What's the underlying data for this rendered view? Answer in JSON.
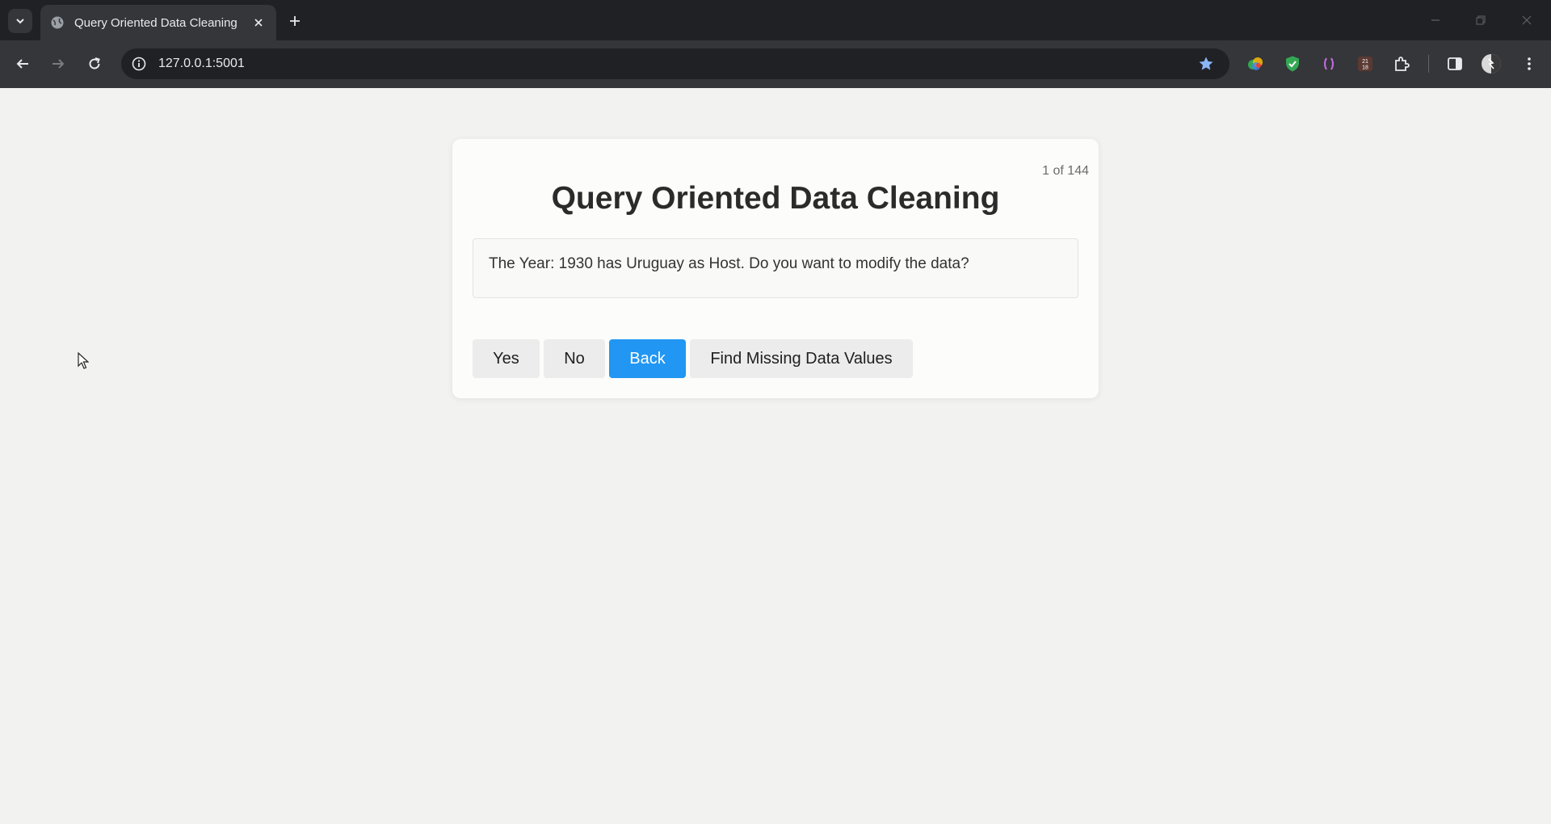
{
  "browser": {
    "tab_title": "Query Oriented Data Cleaning",
    "url": "127.0.0.1:5001",
    "extension_badge": "21\n18",
    "colors": {
      "tabbar": "#202124",
      "toolbar": "#35363a",
      "star": "#8ab4f8"
    }
  },
  "page": {
    "counter": "1 of 144",
    "title": "Query Oriented Data Cleaning",
    "question": "The Year: 1930 has Uruguay as Host. Do you want to modify the data?",
    "buttons": {
      "yes": "Yes",
      "no": "No",
      "back": "Back",
      "find_missing": "Find Missing Data Values"
    },
    "colors": {
      "accent": "#2196f3",
      "button_bg": "#ececec",
      "card_bg": "#fcfcfa"
    }
  }
}
